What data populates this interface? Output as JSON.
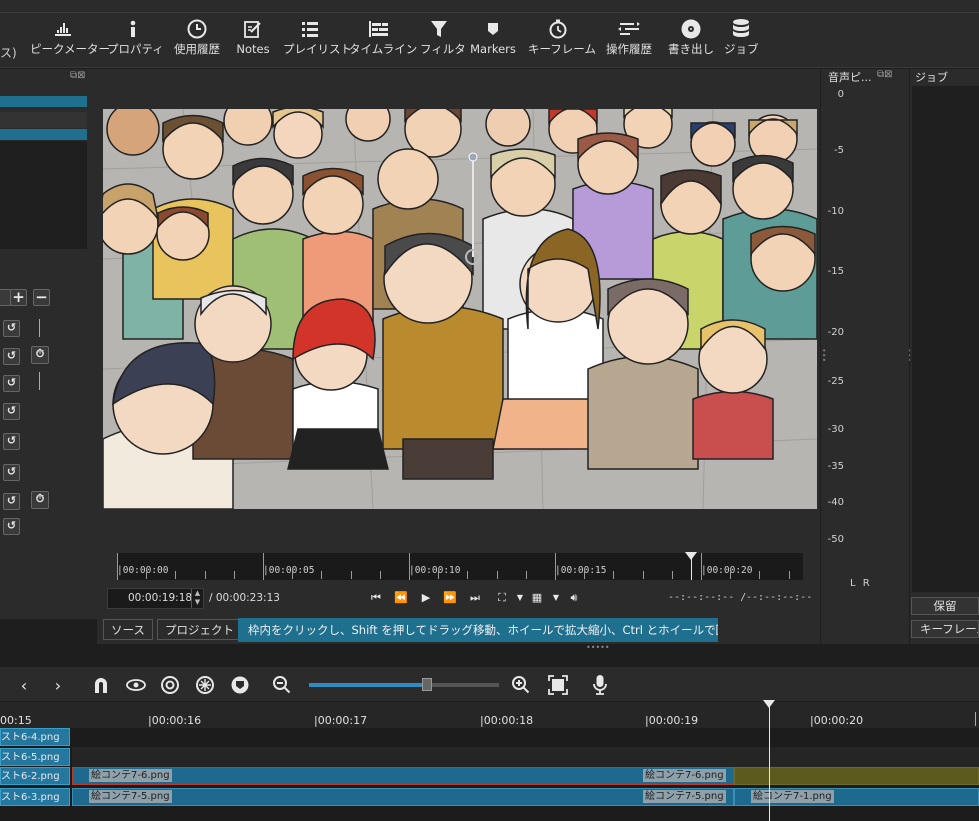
{
  "toolbar": {
    "cut_text": "ス)",
    "items": [
      {
        "label": "ピークメーター",
        "icon": "peak-meter-icon"
      },
      {
        "label": "プロパティ",
        "icon": "info-icon"
      },
      {
        "label": "使用履歴",
        "icon": "clock-icon"
      },
      {
        "label": "Notes",
        "icon": "notes-icon"
      },
      {
        "label": "プレイリスト",
        "icon": "playlist-icon"
      },
      {
        "label": "タイムライン",
        "icon": "timeline-icon"
      },
      {
        "label": "フィルタ",
        "icon": "filter-icon"
      },
      {
        "label": "Markers",
        "icon": "marker-icon"
      },
      {
        "label": "キーフレーム",
        "icon": "stopwatch-icon"
      },
      {
        "label": "操作履歴",
        "icon": "history-icon"
      },
      {
        "label": "書き出し",
        "icon": "disc-icon"
      },
      {
        "label": "ジョブ",
        "icon": "database-icon"
      }
    ]
  },
  "player": {
    "ruler_labels": [
      "|00:00:00",
      "|00:00:05",
      "|00:00:10",
      "|00:00:15",
      "|00:00:20"
    ],
    "playhead_fraction": 0.837,
    "timecode": "00:00:19:18",
    "duration": "/ 00:00:23:13",
    "in_point": "--:--:--:-- /",
    "out_point": "--:--:--:--",
    "tabs": [
      "ソース",
      "プロジェクト"
    ],
    "status_message": "枠内をクリックし、Shift を押してドラッグ移動、ホイールで拡大縮小、Ctrl とホイールで回転します"
  },
  "meter": {
    "title": "音声ピ...",
    "labels": [
      "0",
      "-5",
      "-10",
      "-15",
      "-20",
      "-25",
      "-30",
      "-35",
      "-40",
      "-50"
    ],
    "channels": "L R"
  },
  "jobs": {
    "title": "ジョブ",
    "hold_button": "保留",
    "keyframe_button": "キーフレーム"
  },
  "timeline": {
    "ruler_labels": [
      "00:15",
      "|00:00:16",
      "|00:00:17",
      "|00:00:18",
      "|00:00:19",
      "|00:00:20"
    ],
    "tracks": [
      {
        "name": "スト6-4.png",
        "clips": []
      },
      {
        "name": "スト6-5.png",
        "clips": []
      },
      {
        "name": "スト6-2.png",
        "clips": [
          {
            "label": "絵コンテ7-6.png",
            "label_end": "絵コンテ7-6.png"
          }
        ]
      },
      {
        "name": "スト6-3.png",
        "clips": [
          {
            "label": "絵コンテ7-5.png",
            "label_end": "絵コンテ7-5.png"
          },
          {
            "label": "絵コンテ7-1.png"
          }
        ]
      }
    ]
  },
  "colors": {
    "accent": "#1f6f8f",
    "clip": "#1e6a8e",
    "gap_clip": "#5c5a1e",
    "selected_border": "#c0392b"
  }
}
